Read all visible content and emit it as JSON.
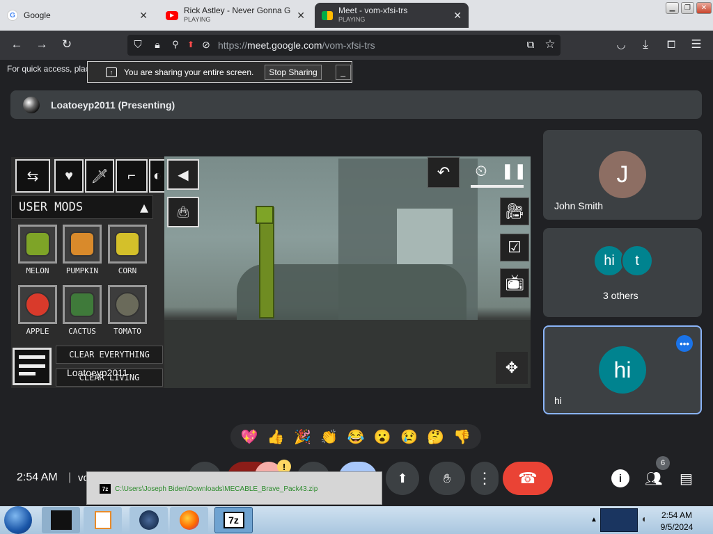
{
  "browser": {
    "tabs": [
      {
        "title": "Google",
        "status": ""
      },
      {
        "title": "Rick Astley - Never Gonna Give",
        "status": "PLAYING"
      },
      {
        "title": "Meet - vom-xfsi-trs",
        "status": "PLAYING"
      }
    ],
    "url_prefix": "https://",
    "url_domain": "meet.google.com",
    "url_path": "/vom-xfsi-trs",
    "bookmarks_note": "For quick access, plac"
  },
  "sharing": {
    "message": "You are sharing your entire screen.",
    "stop_label": "Stop Sharing",
    "minimize_label": "_"
  },
  "presenter": {
    "label": "Loatoeyp2011 (Presenting)"
  },
  "game": {
    "user_mods_label": "USER MODS",
    "mods": [
      {
        "label": "MELON",
        "color": "#7ea427"
      },
      {
        "label": "PUMPKIN",
        "color": "#d98a2b"
      },
      {
        "label": "CORN",
        "color": "#d4c02a"
      },
      {
        "label": "APPLE",
        "color": "#d93a2b"
      },
      {
        "label": "CACTUS",
        "color": "#3f7a3a"
      },
      {
        "label": "TOMATO",
        "color": "#6a6a5a"
      }
    ],
    "clear_everything": "CLEAR EVERYTHING",
    "clear_living": "CLEAR LIVING",
    "cursor_name": "Loatoeyp2011"
  },
  "participants": [
    {
      "name": "John Smith",
      "initial": "J",
      "color": "#8d6e63"
    },
    {
      "name": "3 others",
      "bubbles": [
        "hi",
        "t"
      ],
      "color": "#00838f"
    },
    {
      "name": "hi",
      "initial": "hi",
      "color": "#00838f"
    }
  ],
  "reactions": [
    "💖",
    "👍",
    "🎉",
    "👏",
    "😂",
    "😮",
    "😢",
    "🤔",
    "👎"
  ],
  "bottom": {
    "time": "2:54 AM",
    "separator": "|",
    "meeting_code_partial": "vo",
    "people_count": "6",
    "download_path": "C:\\Users\\Joseph Biden\\Downloads\\MECABLE_Brave_Pack43.zip"
  },
  "taskbar": {
    "time": "2:54 AM",
    "date": "9/5/2024"
  }
}
